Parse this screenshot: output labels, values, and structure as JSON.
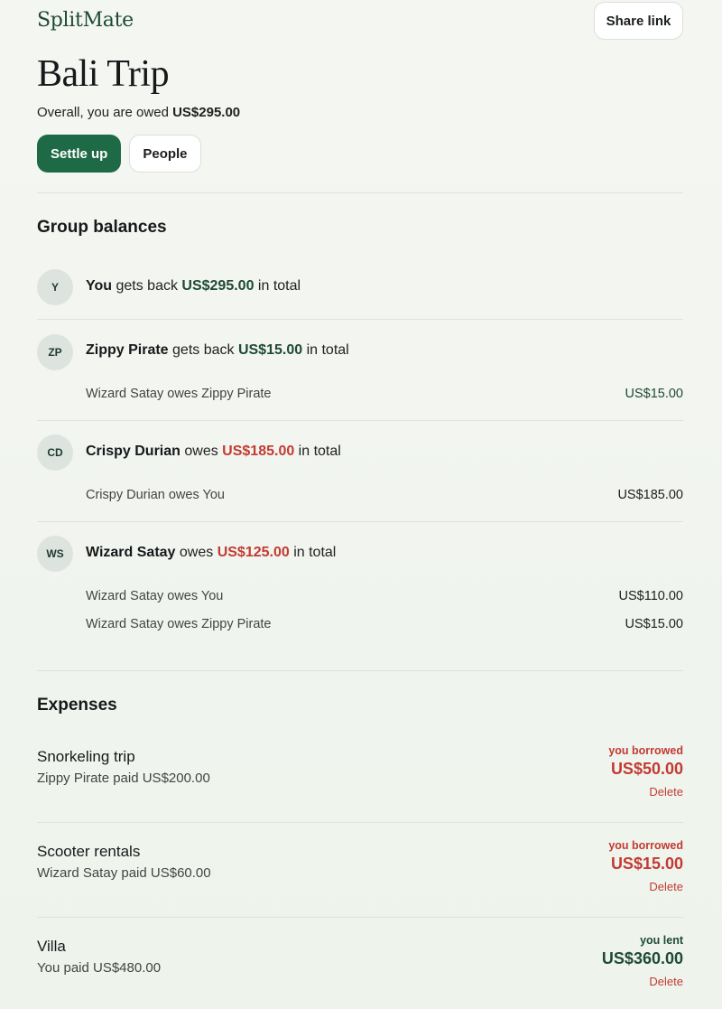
{
  "app": {
    "brand": "SplitMate",
    "share_label": "Share link"
  },
  "group": {
    "title": "Bali Trip",
    "overall_prefix": "Overall, you are owed ",
    "overall_amount": "US$295.00",
    "settle_label": "Settle up",
    "people_label": "People"
  },
  "balances": {
    "heading": "Group balances",
    "items": [
      {
        "initials": "Y",
        "name": "You",
        "verb": " gets back ",
        "amount": "US$295.00",
        "suffix": " in total",
        "sign": "pos",
        "details": []
      },
      {
        "initials": "ZP",
        "name": "Zippy Pirate",
        "verb": " gets back ",
        "amount": "US$15.00",
        "suffix": " in total",
        "sign": "pos",
        "details": [
          {
            "text": "Wizard Satay owes Zippy Pirate",
            "amount": "US$15.00",
            "tone": "pos"
          }
        ]
      },
      {
        "initials": "CD",
        "name": "Crispy Durian",
        "verb": " owes ",
        "amount": "US$185.00",
        "suffix": " in total",
        "sign": "neg",
        "details": [
          {
            "text": "Crispy Durian owes You",
            "amount": "US$185.00",
            "tone": "neutral"
          }
        ]
      },
      {
        "initials": "WS",
        "name": "Wizard Satay",
        "verb": " owes ",
        "amount": "US$125.00",
        "suffix": " in total",
        "sign": "neg",
        "details": [
          {
            "text": "Wizard Satay owes You",
            "amount": "US$110.00",
            "tone": "neutral"
          },
          {
            "text": "Wizard Satay owes Zippy Pirate",
            "amount": "US$15.00",
            "tone": "neutral"
          }
        ]
      }
    ]
  },
  "expenses": {
    "heading": "Expenses",
    "items": [
      {
        "name": "Snorkeling trip",
        "paid": "Zippy Pirate paid US$200.00",
        "tag": "you borrowed",
        "amount": "US$50.00",
        "sign": "neg",
        "delete_label": "Delete"
      },
      {
        "name": "Scooter rentals",
        "paid": "Wizard Satay paid US$60.00",
        "tag": "you borrowed",
        "amount": "US$15.00",
        "sign": "neg",
        "delete_label": "Delete"
      },
      {
        "name": "Villa",
        "paid": "You paid US$480.00",
        "tag": "you lent",
        "amount": "US$360.00",
        "sign": "pos",
        "delete_label": "Delete"
      }
    ]
  }
}
